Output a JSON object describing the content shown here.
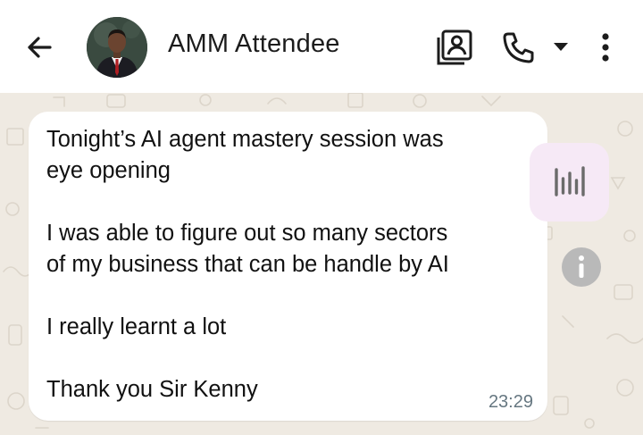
{
  "header": {
    "contact_name": "AMM Attendee",
    "icons": [
      "back-arrow-icon",
      "avatar",
      "contact-card-icon",
      "phone-icon",
      "dropdown-caret-icon",
      "more-vert-icon"
    ]
  },
  "message": {
    "lines": [
      "Tonight’s AI agent mastery session was",
      "eye opening",
      "I was able to figure out so many sectors",
      "of my business that can be handle by AI",
      "I really learnt a lot",
      "Thank you Sir Kenny"
    ],
    "time": "23:29"
  },
  "side_actions": {
    "transcribe_icon": "audio-waveform-icon",
    "info_icon": "info-icon"
  },
  "colors": {
    "chat_background": "#efeae2",
    "bubble": "#ffffff",
    "timestamp": "#667781",
    "transcribe_bg": "#f6e9f6",
    "info_bg": "#b9b9b9"
  }
}
